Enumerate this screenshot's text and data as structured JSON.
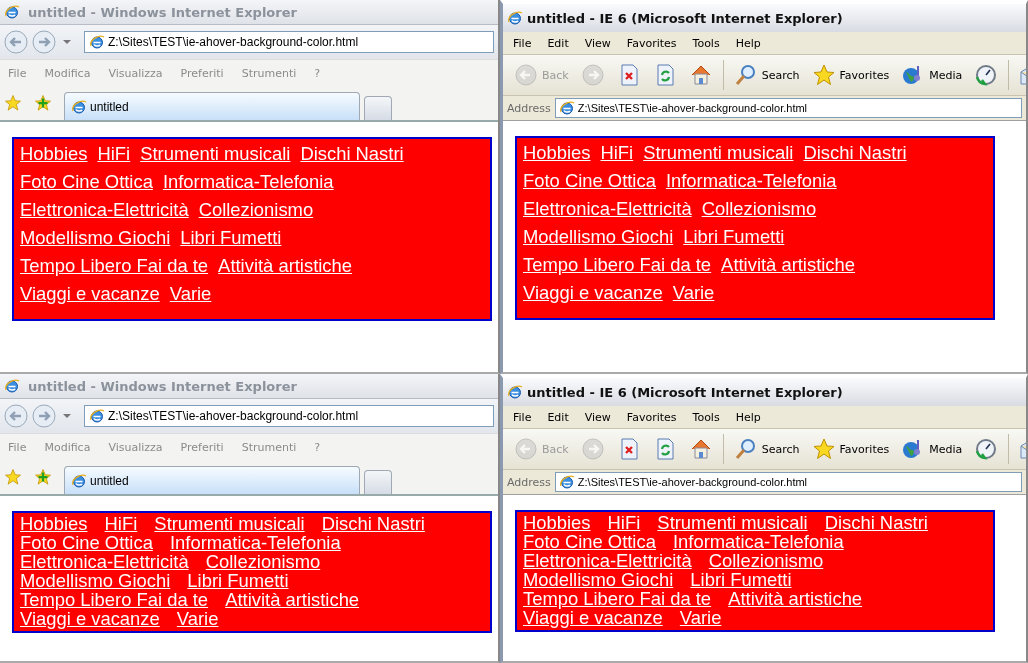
{
  "windows": [
    {
      "kind": "ie7",
      "title": "untitled - Windows Internet Explorer",
      "address": "Z:\\Sites\\TEST\\ie-ahover-background-color.html",
      "menu": [
        "File",
        "Modifica",
        "Visualizza",
        "Preferiti",
        "Strumenti",
        "?"
      ],
      "tabs": [
        {
          "label": "untitled",
          "selected": true
        }
      ],
      "page": {
        "kind": "float",
        "links": [
          "Hobbies",
          "HiFi",
          "Strumenti musicali",
          "Dischi Nastri",
          "Foto Cine Ottica",
          "Informatica-Telefonia",
          "Elettronica-Elettricità",
          "Collezionismo",
          "Modellismo Giochi",
          "Libri Fumetti",
          "Tempo Libero Fai da te",
          "Attività artistiche",
          "Viaggi e vacanze",
          "Varie"
        ]
      }
    },
    {
      "kind": "ie6",
      "title": "untitled - IE 6 (Microsoft Internet Explorer)",
      "menu": [
        "File",
        "Edit",
        "View",
        "Favorites",
        "Tools",
        "Help"
      ],
      "toolbar": [
        {
          "kind": "back",
          "label": "Back",
          "disabled": true
        },
        {
          "kind": "forward",
          "disabled": true
        },
        {
          "kind": "stop",
          "disabled": false
        },
        {
          "kind": "refresh",
          "disabled": false
        },
        {
          "kind": "home",
          "disabled": false
        },
        {
          "kind": "search",
          "label": "Search",
          "disabled": false
        },
        {
          "kind": "favorites",
          "label": "Favorites",
          "disabled": false
        },
        {
          "kind": "media",
          "label": "Media",
          "disabled": false
        },
        {
          "kind": "history",
          "disabled": false
        },
        {
          "kind": "mail",
          "disabled": false
        }
      ],
      "address_label": "Address",
      "address": "Z:\\Sites\\TEST\\ie-ahover-background-color.html",
      "page": {
        "kind": "float",
        "links": [
          "Hobbies",
          "HiFi",
          "Strumenti musicali",
          "Dischi Nastri",
          "Foto Cine Ottica",
          "Informatica-Telefonia",
          "Elettronica-Elettricità",
          "Collezionismo",
          "Modellismo Giochi",
          "Libri Fumetti",
          "Tempo Libero Fai da te",
          "Attività artistiche",
          "Viaggi e vacanze",
          "Varie"
        ]
      }
    },
    {
      "kind": "ie7",
      "title": "untitled - Windows Internet Explorer",
      "address": "Z:\\Sites\\TEST\\ie-ahover-background-color.html",
      "menu": [
        "File",
        "Modifica",
        "Visualizza",
        "Preferiti",
        "Strumenti",
        "?"
      ],
      "tabs": [
        {
          "label": "untitled",
          "selected": true
        }
      ],
      "page": {
        "kind": "inline",
        "links": [
          "Hobbies",
          "HiFi",
          "Strumenti musicali",
          "Dischi Nastri",
          "Foto Cine Ottica",
          "Informatica-Telefonia",
          "Elettronica-Elettricità",
          "Collezionismo",
          "Modellismo Giochi",
          "Libri Fumetti",
          "Tempo Libero Fai da te",
          "Attività artistiche",
          "Viaggi e vacanze",
          "Varie"
        ]
      }
    },
    {
      "kind": "ie6",
      "title": "untitled - IE 6 (Microsoft Internet Explorer)",
      "menu": [
        "File",
        "Edit",
        "View",
        "Favorites",
        "Tools",
        "Help"
      ],
      "toolbar": [
        {
          "kind": "back",
          "label": "Back",
          "disabled": true
        },
        {
          "kind": "forward",
          "disabled": true
        },
        {
          "kind": "stop",
          "disabled": false
        },
        {
          "kind": "refresh",
          "disabled": false
        },
        {
          "kind": "home",
          "disabled": false
        },
        {
          "kind": "search",
          "label": "Search",
          "disabled": false
        },
        {
          "kind": "favorites",
          "label": "Favorites",
          "disabled": false
        },
        {
          "kind": "media",
          "label": "Media",
          "disabled": false
        },
        {
          "kind": "history",
          "disabled": false
        },
        {
          "kind": "mail",
          "disabled": false
        }
      ],
      "address_label": "Address",
      "address": "Z:\\Sites\\TEST\\ie-ahover-background-color.html",
      "page": {
        "kind": "inline",
        "links": [
          "Hobbies",
          "HiFi",
          "Strumenti musicali",
          "Dischi Nastri",
          "Foto Cine Ottica",
          "Informatica-Telefonia",
          "Elettronica-Elettricità",
          "Collezionismo",
          "Modellismo Giochi",
          "Libri Fumetti",
          "Tempo Libero Fai da te",
          "Attività artistiche",
          "Viaggi e vacanze",
          "Varie"
        ]
      }
    }
  ]
}
